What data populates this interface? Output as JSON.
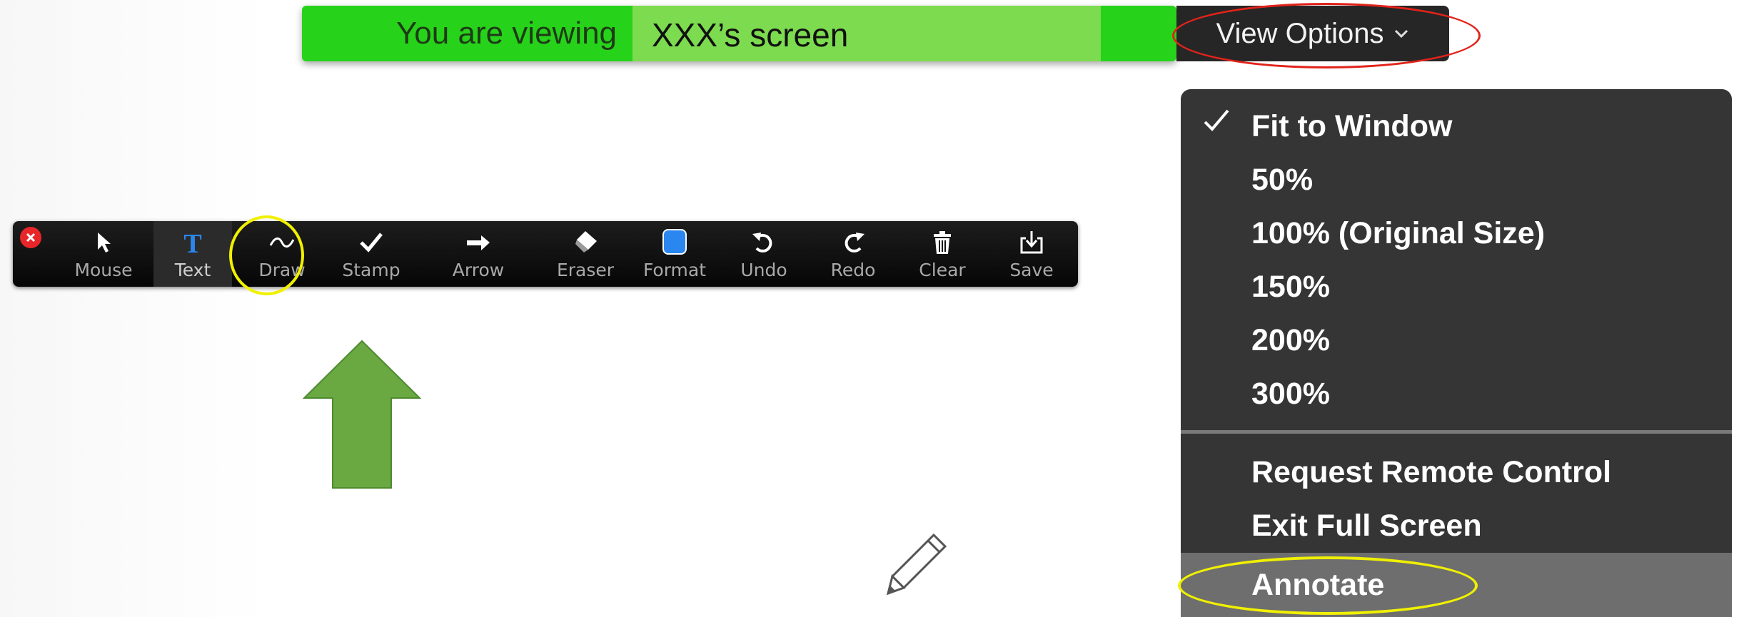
{
  "banner": {
    "prefix": "You are viewing",
    "name": "XXX’s screen"
  },
  "view_options": {
    "label": "View Options"
  },
  "menu": {
    "zoom_items": [
      {
        "label": "Fit to Window",
        "checked": true
      },
      {
        "label": "50%",
        "checked": false
      },
      {
        "label": "100% (Original Size)",
        "checked": false
      },
      {
        "label": "150%",
        "checked": false
      },
      {
        "label": "200%",
        "checked": false
      },
      {
        "label": "300%",
        "checked": false
      }
    ],
    "action_items": [
      {
        "label": "Request Remote Control"
      },
      {
        "label": "Exit Full Screen"
      },
      {
        "label": "Annotate",
        "highlighted": true
      }
    ]
  },
  "toolbar": {
    "tools": [
      {
        "label": "Mouse",
        "icon": "pointer-icon"
      },
      {
        "label": "Text",
        "icon": "text-t-icon",
        "active": true
      },
      {
        "label": "Draw",
        "icon": "squiggle-icon"
      },
      {
        "label": "Stamp",
        "icon": "checkmark-icon"
      },
      {
        "label": "Arrow",
        "icon": "right-arrow-icon"
      },
      {
        "label": "Eraser",
        "icon": "eraser-icon"
      },
      {
        "label": "Format",
        "icon": "blue-square-icon"
      },
      {
        "label": "Undo",
        "icon": "undo-icon"
      },
      {
        "label": "Redo",
        "icon": "redo-icon"
      },
      {
        "label": "Clear",
        "icon": "trash-icon"
      },
      {
        "label": "Save",
        "icon": "save-download-icon"
      }
    ]
  },
  "colors": {
    "banner_green": "#26d31a",
    "banner_name_green": "#7ddb4f",
    "callout_red": "#e2231a",
    "callout_yellow": "#f0f000",
    "arrow_green": "#6aa842",
    "format_blue": "#2a87f0"
  }
}
